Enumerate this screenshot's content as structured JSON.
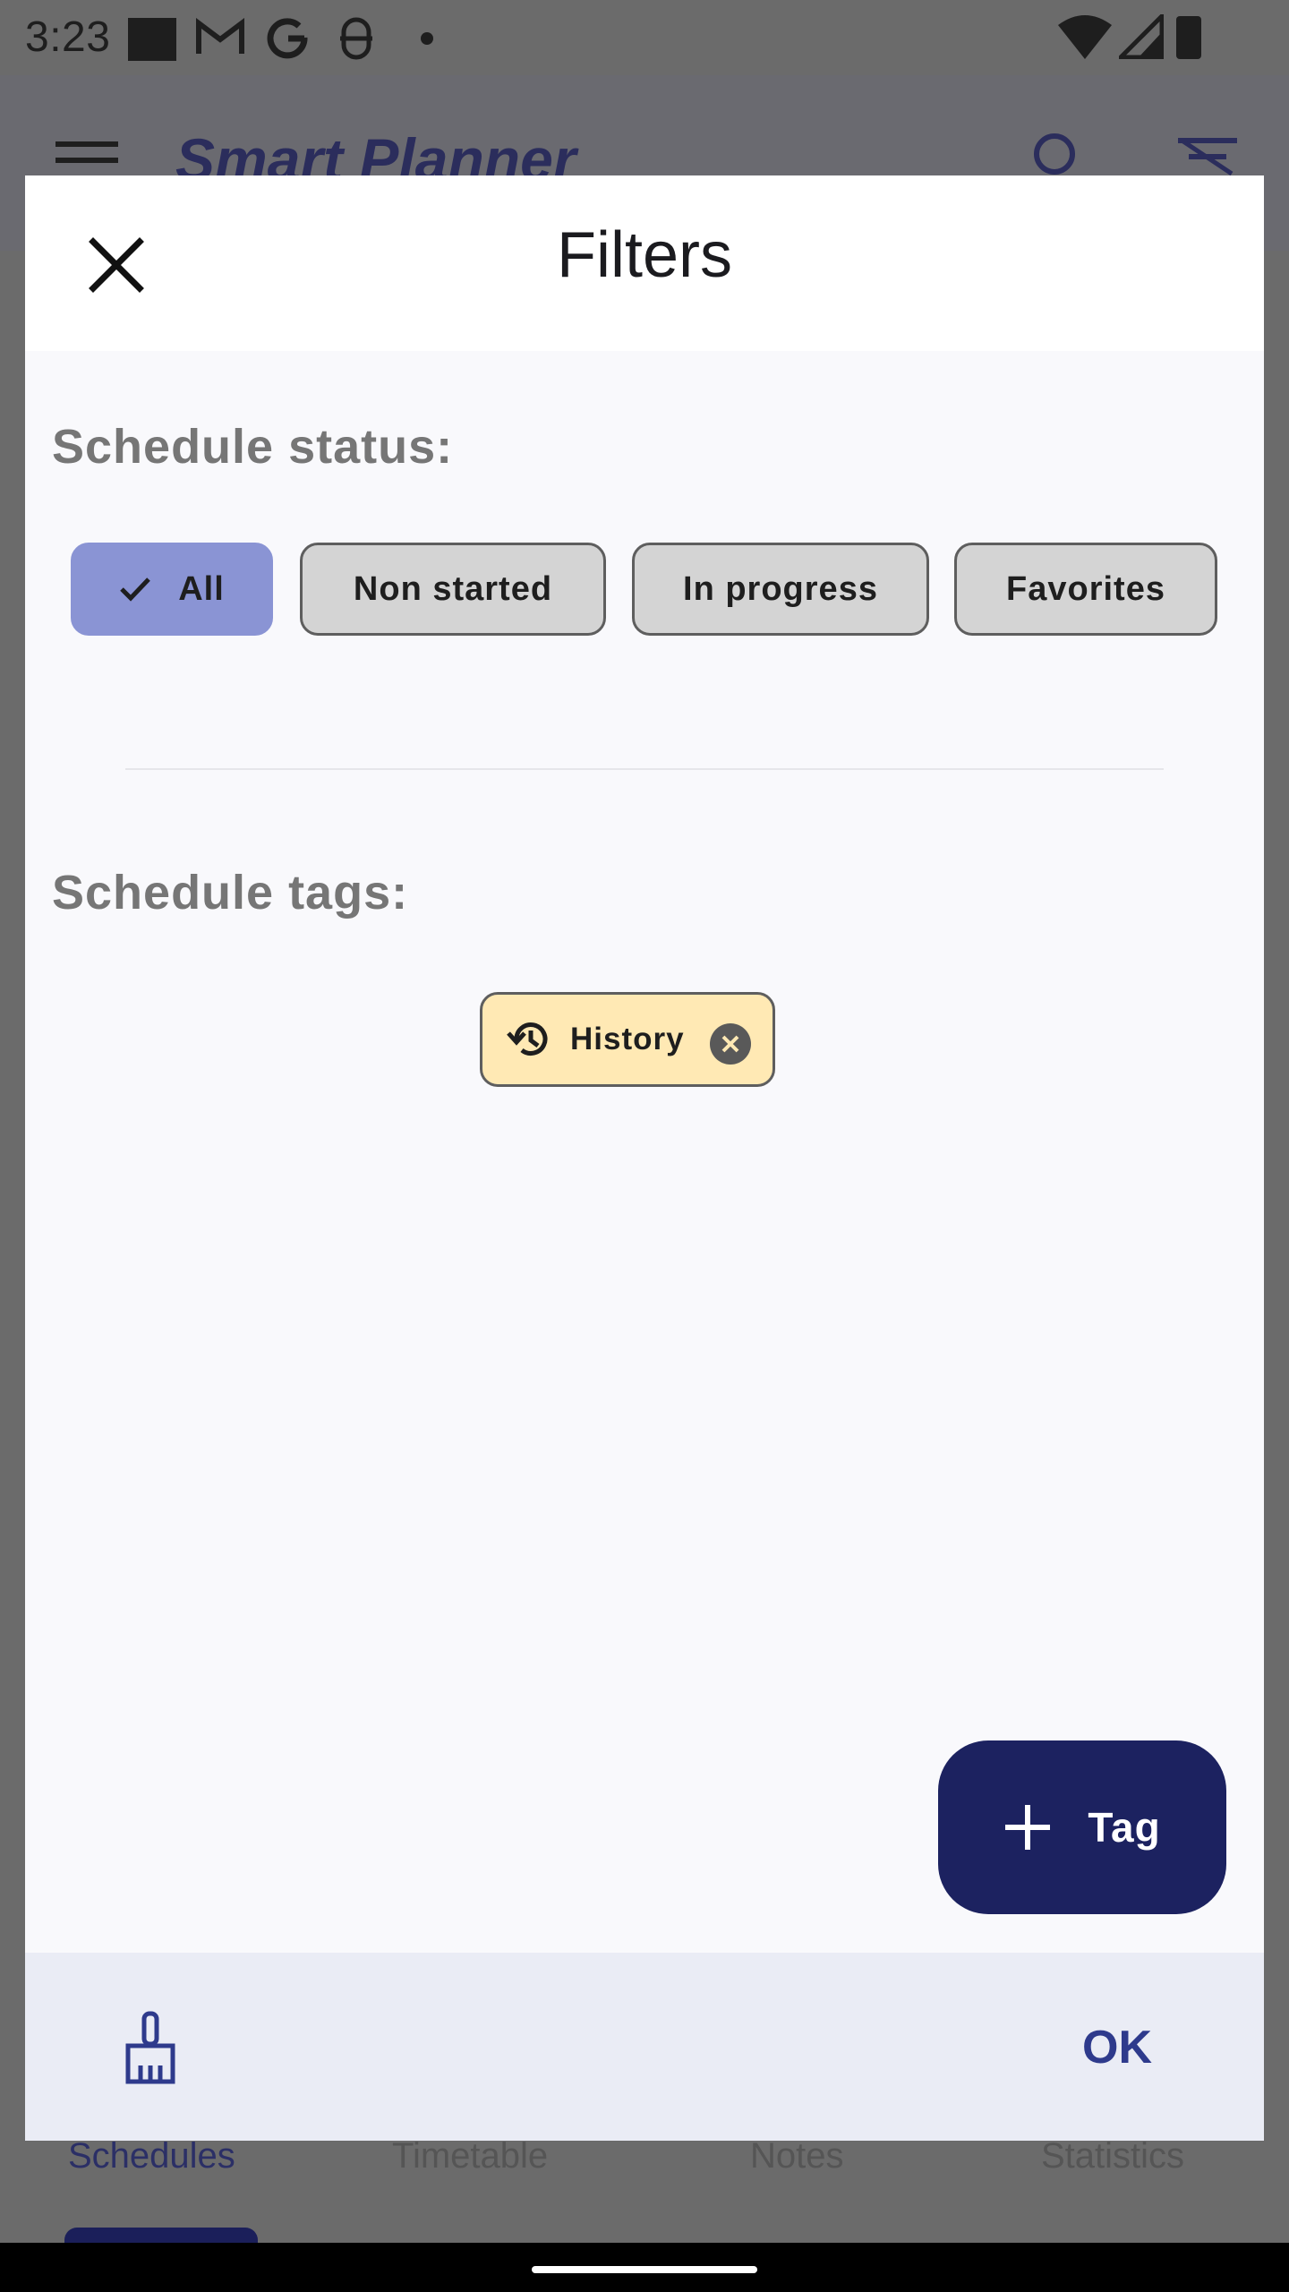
{
  "status_bar": {
    "time": "3:23",
    "icons": [
      "square-icon",
      "gmail-icon",
      "google-icon",
      "sync-icon",
      "dot-icon",
      "wifi-icon",
      "signal-icon",
      "battery-icon"
    ]
  },
  "app": {
    "title": "Smart Planner",
    "nav_items": [
      "Schedules",
      "Timetable",
      "Notes",
      "Statistics"
    ],
    "accent_color": "#2b2f66"
  },
  "dialog": {
    "title": "Filters",
    "status_section": {
      "label": "Schedule status:",
      "chips": [
        {
          "label": "All",
          "selected": true
        },
        {
          "label": "Non started",
          "selected": false
        },
        {
          "label": "In progress",
          "selected": false
        },
        {
          "label": "Favorites",
          "selected": false
        }
      ]
    },
    "tags_section": {
      "label": "Schedule tags:",
      "tags": [
        {
          "label": "History",
          "icon": "history-icon",
          "color": "#ffe9b4"
        }
      ]
    },
    "add_tag_button": {
      "label": "Tag",
      "color": "#1c2260"
    },
    "footer": {
      "ok_label": "OK",
      "clear_icon": "broom-icon"
    }
  }
}
